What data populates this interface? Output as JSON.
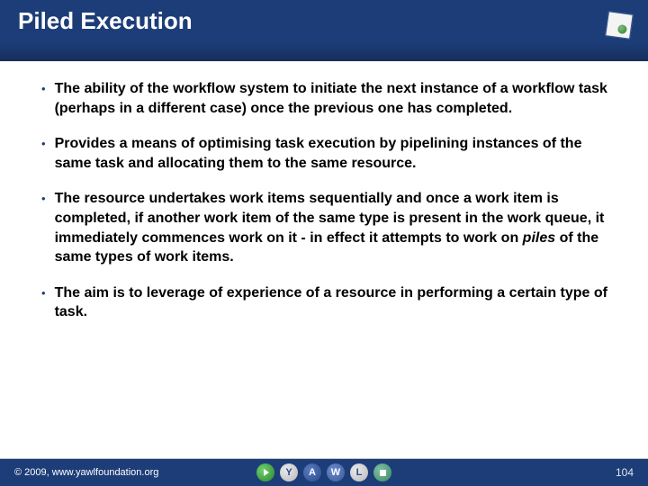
{
  "header": {
    "title": "Piled Execution"
  },
  "bullets": [
    {
      "text": "The ability of the workflow system to initiate the next instance of a workflow task (perhaps in a different case) once the previous one has completed."
    },
    {
      "text": "Provides a means of optimising task execution by pipelining instances of the same task and allocating them to the same resource."
    },
    {
      "text_pre": "The resource undertakes work items sequentially and once a work item is completed, if another work item of the same type is present in the work queue, it immediately commences work on it - in effect it attempts to work on ",
      "text_italic": "piles",
      "text_post": " of the same types of work items."
    },
    {
      "text": "The aim is to leverage of experience of a resource in performing a certain type of task."
    }
  ],
  "footer": {
    "copyright": "© 2009, www.yawlfoundation.org",
    "page_number": "104",
    "logo_letters": {
      "y": "Y",
      "a": "A",
      "w": "W",
      "l": "L"
    }
  }
}
